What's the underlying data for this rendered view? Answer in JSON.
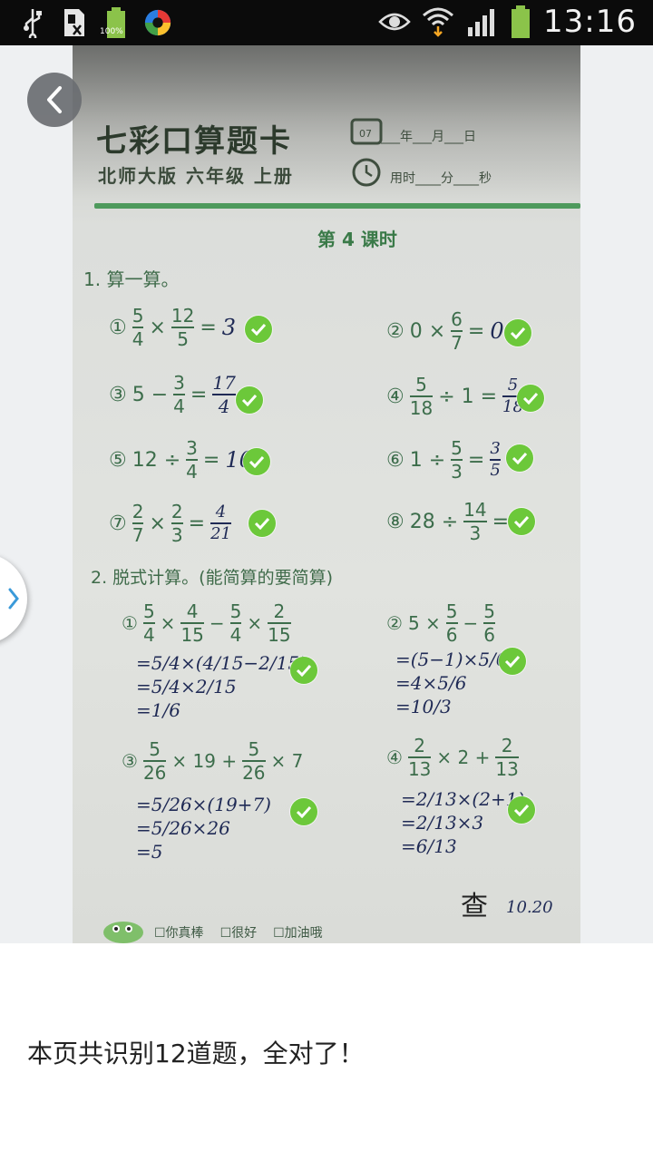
{
  "status_bar": {
    "battery_small": "100%",
    "time": "13:16"
  },
  "worksheet": {
    "brand": "七彩口算题卡",
    "edition": "北师大版 六年级 上册",
    "date_line": "___年___月___日",
    "time_line": "用时____分____秒",
    "lesson": "第 4 课时",
    "section1": "1. 算一算。",
    "section2": "2. 脱式计算。(能简算的要简算)",
    "rating_great": "☐你真棒",
    "rating_good": "☐很好",
    "rating_keep": "☐加油哦",
    "signature": "查",
    "sign_date": "10.20"
  },
  "result": {
    "text": "本页共识别12道题，全对了！"
  },
  "colors": {
    "check": "#6cc83a",
    "ink": "#1f2a55",
    "print_green": "#3c6d4b"
  }
}
